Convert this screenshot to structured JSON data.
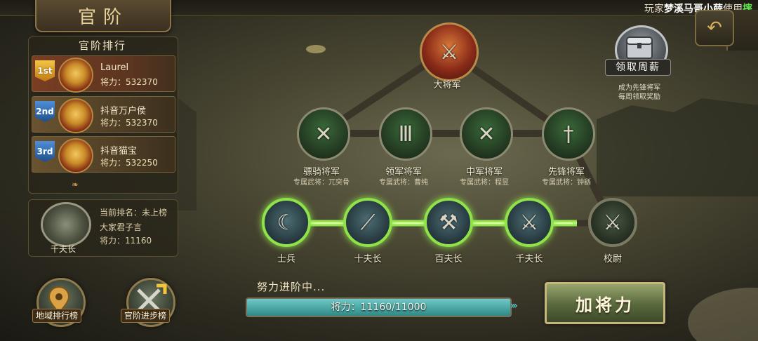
{
  "header": {
    "title": "官阶",
    "marquee": {
      "prefix": "玩家",
      "player": "梦溪马哥小薛",
      "action": "使用",
      "item": "摔"
    }
  },
  "ranking": {
    "title": "官阶排行",
    "entries": [
      {
        "medal": "1st",
        "name": "Laurel",
        "power_label": "将力：",
        "power": "532370"
      },
      {
        "medal": "2nd",
        "name": "抖音万户侯",
        "power_label": "将力：",
        "power": "532370"
      },
      {
        "medal": "3rd",
        "name": "抖音猫宝",
        "power_label": "将力：",
        "power": "532250"
      }
    ]
  },
  "my_rank": {
    "rank_title": "千夫长",
    "current_label": "当前排名：",
    "current_value": "未上榜",
    "name": "大家君子言",
    "power_label": "将力：",
    "power": "11160"
  },
  "buttons": {
    "region_ranking": "地域排行榜",
    "progress_ranking": "官阶进步榜",
    "weekly_pay": "领取周薪",
    "weekly_note_1": "成为先锋将军",
    "weekly_note_2": "每周领取奖励",
    "boost": "加将力"
  },
  "tree": {
    "top": {
      "label": "大将军"
    },
    "generals": [
      {
        "label": "骠骑将军",
        "sub": "专属武将：兀突骨"
      },
      {
        "label": "领军将军",
        "sub": "专属武将：曹纯"
      },
      {
        "label": "中军将军",
        "sub": "专属武将：程昱"
      },
      {
        "label": "先锋将军",
        "sub": "专属武将：钟繇"
      }
    ],
    "soldiers": [
      {
        "label": "士兵",
        "state": "achieved"
      },
      {
        "label": "十夫长",
        "state": "achieved"
      },
      {
        "label": "百夫长",
        "state": "achieved"
      },
      {
        "label": "千夫长",
        "state": "achieved"
      },
      {
        "label": "校尉",
        "state": "locked"
      }
    ]
  },
  "progress": {
    "status": "努力进阶中...",
    "text": "将力：11160/11000",
    "fraction": 1.0
  },
  "colors": {
    "active_green": "#8fe24a",
    "progress": "#3fa8a4",
    "accent_gold": "#c8b57a"
  }
}
